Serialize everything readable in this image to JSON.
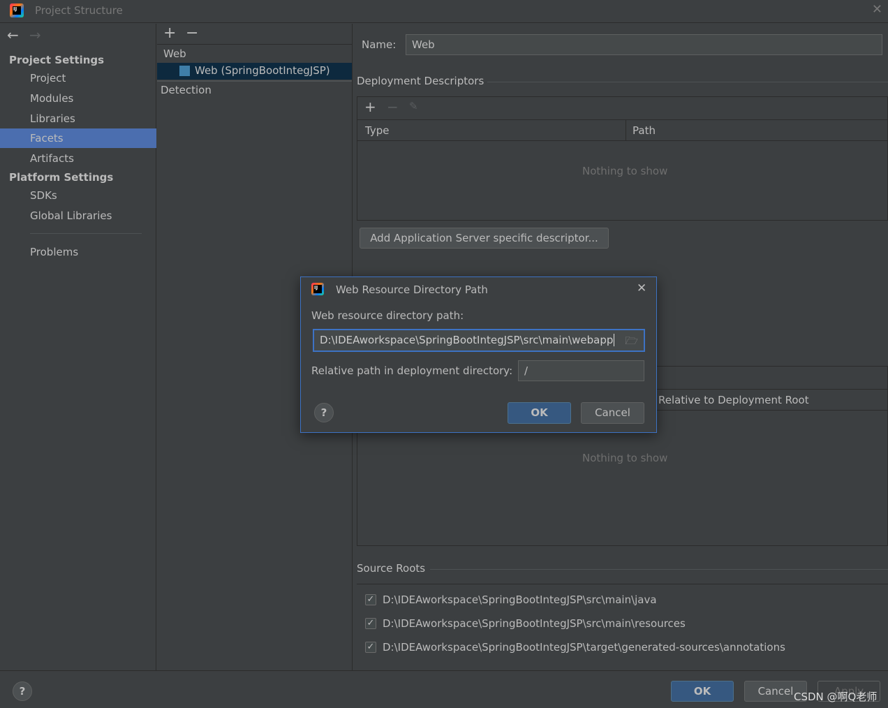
{
  "window": {
    "title": "Project Structure"
  },
  "sidebar": {
    "project_settings": "Project Settings",
    "items": [
      {
        "label": "Project"
      },
      {
        "label": "Modules"
      },
      {
        "label": "Libraries"
      },
      {
        "label": "Facets",
        "selected": true
      },
      {
        "label": "Artifacts"
      }
    ],
    "platform_settings": "Platform Settings",
    "platform_items": [
      {
        "label": "SDKs"
      },
      {
        "label": "Global Libraries"
      }
    ],
    "problems": "Problems"
  },
  "facet_tree": {
    "group": "Web",
    "item": "Web (SpringBootIntegJSP)",
    "detection": "Detection"
  },
  "facet_editor": {
    "name_label": "Name:",
    "name_value": "Web",
    "deployment_descriptors": "Deployment Descriptors",
    "columns": [
      "Type",
      "Path"
    ],
    "empty_text": "Nothing to show",
    "add_descriptor_button": "Add Application Server specific descriptor...",
    "web_roots_column": "Relative to Deployment Root",
    "empty_text2": "Nothing to show",
    "source_roots": "Source Roots",
    "roots": [
      {
        "path": "D:\\IDEAworkspace\\SpringBootIntegJSP\\src\\main\\java",
        "checked": true
      },
      {
        "path": "D:\\IDEAworkspace\\SpringBootIntegJSP\\src\\main\\resources",
        "checked": true
      },
      {
        "path": "D:\\IDEAworkspace\\SpringBootIntegJSP\\target\\generated-sources\\annotations",
        "checked": true
      }
    ]
  },
  "dialog": {
    "title": "Web Resource Directory Path",
    "path_label": "Web resource directory path:",
    "path_value": "D:\\IDEAworkspace\\SpringBootIntegJSP\\src\\main\\webapp",
    "relative_label": "Relative path in deployment directory:",
    "relative_value": "/",
    "ok": "OK",
    "cancel": "Cancel"
  },
  "footer": {
    "ok": "OK",
    "cancel": "Cancel",
    "apply": "Apply",
    "watermark": "CSDN @啊Q老师"
  },
  "colors": {
    "selection": "#4b6eaf",
    "primary_button": "#365880",
    "dialog_border": "#3d72c4"
  }
}
